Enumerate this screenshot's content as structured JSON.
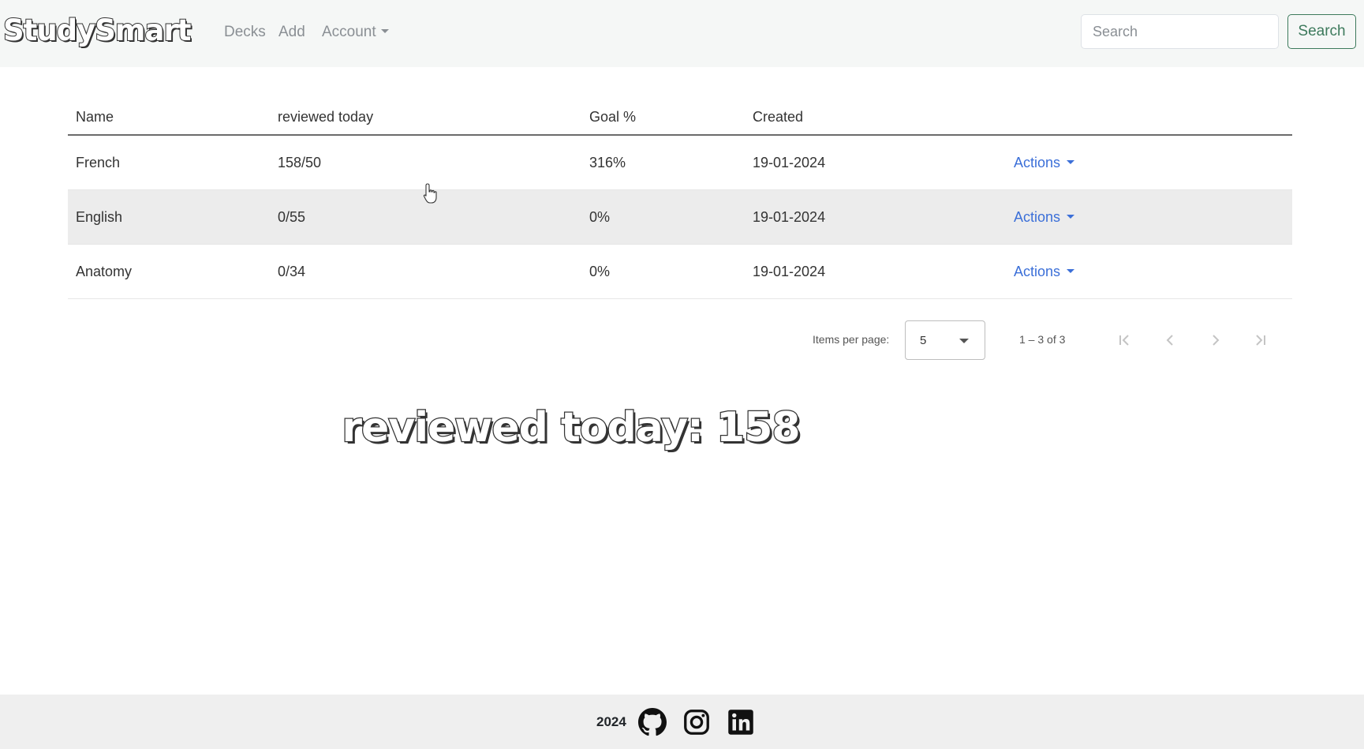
{
  "navbar": {
    "brand": "StudySmart",
    "links": {
      "decks": "Decks",
      "add": "Add",
      "account": "Account"
    },
    "search_placeholder": "Search",
    "search_button": "Search"
  },
  "table": {
    "headers": {
      "name": "Name",
      "reviewed": "reviewed today",
      "goal": "Goal %",
      "created": "Created"
    },
    "rows": [
      {
        "name": "French",
        "reviewed": "158/50",
        "goal": "316%",
        "created": "19-01-2024",
        "actions": "Actions"
      },
      {
        "name": "English",
        "reviewed": "0/55",
        "goal": "0%",
        "created": "19-01-2024",
        "actions": "Actions"
      },
      {
        "name": "Anatomy",
        "reviewed": "0/34",
        "goal": "0%",
        "created": "19-01-2024",
        "actions": "Actions"
      }
    ]
  },
  "paginator": {
    "items_per_page_label": "Items per page:",
    "items_per_page_value": "5",
    "range_label": "1 – 3 of 3"
  },
  "overlay_text": "reviewed today: 158",
  "footer": {
    "year": "2024",
    "icons": [
      "github-icon",
      "instagram-icon",
      "linkedin-icon"
    ]
  },
  "colors": {
    "accent_green": "#3d7a5c",
    "link_blue": "#3b6fd8",
    "navbar_bg": "#f5f7f6",
    "footer_bg": "#efefef",
    "alt_row_bg": "#ececec"
  }
}
